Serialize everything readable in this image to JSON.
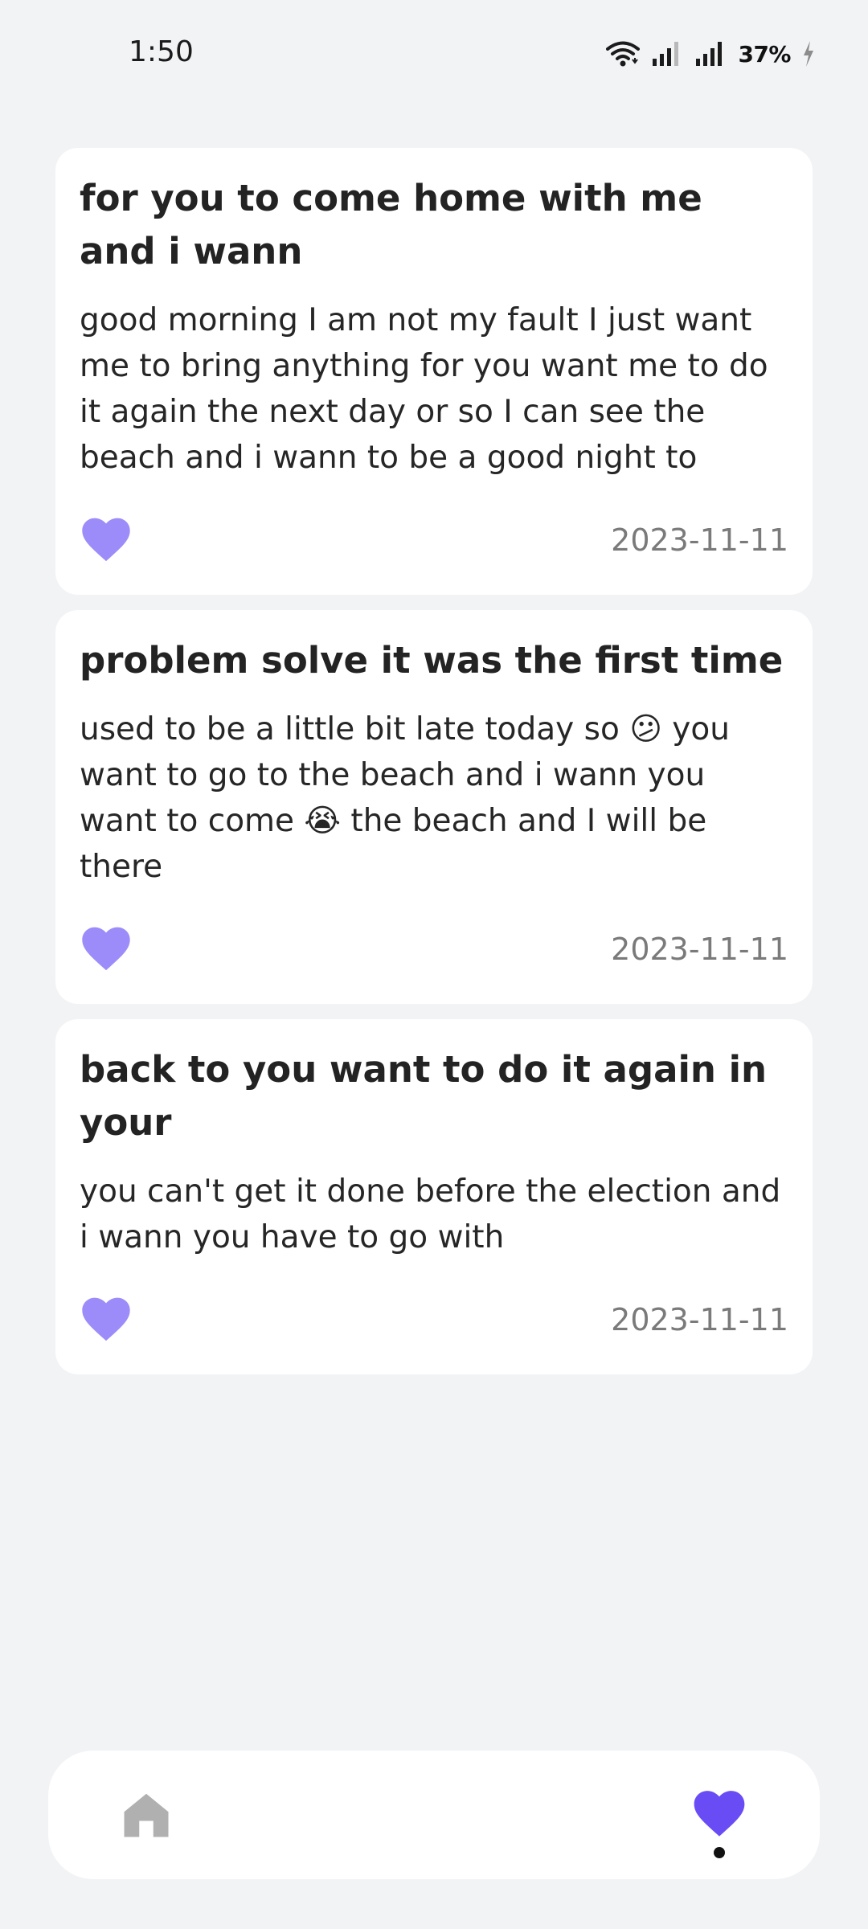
{
  "status_bar": {
    "time": "1:50",
    "battery_percent": "37%"
  },
  "colors": {
    "accent_heart": "#9b8cfa",
    "nav_active_heart": "#6a4cf5",
    "nav_inactive": "#b0b0b0",
    "background": "#f2f3f5",
    "card": "#ffffff"
  },
  "notes": [
    {
      "title": "for you to come home with me and i wann",
      "body": "good morning I am not my fault I just want me to bring anything for you want me to do it again the next day or so I can see the beach and i wann to be a good night to",
      "date": "2023-11-11",
      "icon": "heart-icon"
    },
    {
      "title": "problem solve it was the first time",
      "body": "used to be a little bit late today so 😕 you want to go to the beach and i wann you want to come 😭 the beach and I will be there",
      "date": "2023-11-11",
      "icon": "heart-icon"
    },
    {
      "title": "back to you want to do it again in your",
      "body": "you can't get it done before the election and i wann you have to go with",
      "date": "2023-11-11",
      "icon": "heart-icon"
    }
  ],
  "bottom_nav": {
    "items": [
      {
        "icon": "home-icon",
        "active": false
      },
      {
        "icon": "heart-icon",
        "active": true
      }
    ]
  }
}
